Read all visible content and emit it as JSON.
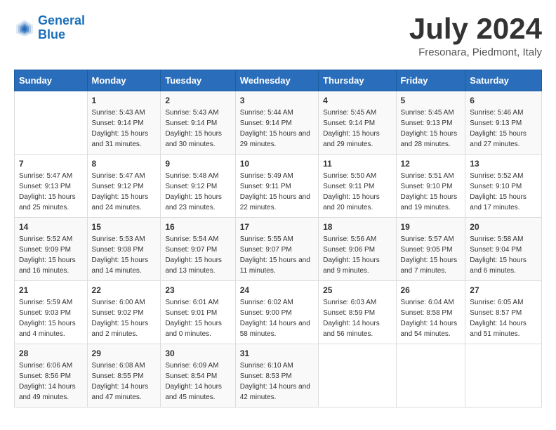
{
  "header": {
    "logo_line1": "General",
    "logo_line2": "Blue",
    "month": "July 2024",
    "location": "Fresonara, Piedmont, Italy"
  },
  "days_of_week": [
    "Sunday",
    "Monday",
    "Tuesday",
    "Wednesday",
    "Thursday",
    "Friday",
    "Saturday"
  ],
  "weeks": [
    [
      {
        "day": "",
        "sunrise": "",
        "sunset": "",
        "daylight": ""
      },
      {
        "day": "1",
        "sunrise": "Sunrise: 5:43 AM",
        "sunset": "Sunset: 9:14 PM",
        "daylight": "Daylight: 15 hours and 31 minutes."
      },
      {
        "day": "2",
        "sunrise": "Sunrise: 5:43 AM",
        "sunset": "Sunset: 9:14 PM",
        "daylight": "Daylight: 15 hours and 30 minutes."
      },
      {
        "day": "3",
        "sunrise": "Sunrise: 5:44 AM",
        "sunset": "Sunset: 9:14 PM",
        "daylight": "Daylight: 15 hours and 29 minutes."
      },
      {
        "day": "4",
        "sunrise": "Sunrise: 5:45 AM",
        "sunset": "Sunset: 9:14 PM",
        "daylight": "Daylight: 15 hours and 29 minutes."
      },
      {
        "day": "5",
        "sunrise": "Sunrise: 5:45 AM",
        "sunset": "Sunset: 9:13 PM",
        "daylight": "Daylight: 15 hours and 28 minutes."
      },
      {
        "day": "6",
        "sunrise": "Sunrise: 5:46 AM",
        "sunset": "Sunset: 9:13 PM",
        "daylight": "Daylight: 15 hours and 27 minutes."
      }
    ],
    [
      {
        "day": "7",
        "sunrise": "Sunrise: 5:47 AM",
        "sunset": "Sunset: 9:13 PM",
        "daylight": "Daylight: 15 hours and 25 minutes."
      },
      {
        "day": "8",
        "sunrise": "Sunrise: 5:47 AM",
        "sunset": "Sunset: 9:12 PM",
        "daylight": "Daylight: 15 hours and 24 minutes."
      },
      {
        "day": "9",
        "sunrise": "Sunrise: 5:48 AM",
        "sunset": "Sunset: 9:12 PM",
        "daylight": "Daylight: 15 hours and 23 minutes."
      },
      {
        "day": "10",
        "sunrise": "Sunrise: 5:49 AM",
        "sunset": "Sunset: 9:11 PM",
        "daylight": "Daylight: 15 hours and 22 minutes."
      },
      {
        "day": "11",
        "sunrise": "Sunrise: 5:50 AM",
        "sunset": "Sunset: 9:11 PM",
        "daylight": "Daylight: 15 hours and 20 minutes."
      },
      {
        "day": "12",
        "sunrise": "Sunrise: 5:51 AM",
        "sunset": "Sunset: 9:10 PM",
        "daylight": "Daylight: 15 hours and 19 minutes."
      },
      {
        "day": "13",
        "sunrise": "Sunrise: 5:52 AM",
        "sunset": "Sunset: 9:10 PM",
        "daylight": "Daylight: 15 hours and 17 minutes."
      }
    ],
    [
      {
        "day": "14",
        "sunrise": "Sunrise: 5:52 AM",
        "sunset": "Sunset: 9:09 PM",
        "daylight": "Daylight: 15 hours and 16 minutes."
      },
      {
        "day": "15",
        "sunrise": "Sunrise: 5:53 AM",
        "sunset": "Sunset: 9:08 PM",
        "daylight": "Daylight: 15 hours and 14 minutes."
      },
      {
        "day": "16",
        "sunrise": "Sunrise: 5:54 AM",
        "sunset": "Sunset: 9:07 PM",
        "daylight": "Daylight: 15 hours and 13 minutes."
      },
      {
        "day": "17",
        "sunrise": "Sunrise: 5:55 AM",
        "sunset": "Sunset: 9:07 PM",
        "daylight": "Daylight: 15 hours and 11 minutes."
      },
      {
        "day": "18",
        "sunrise": "Sunrise: 5:56 AM",
        "sunset": "Sunset: 9:06 PM",
        "daylight": "Daylight: 15 hours and 9 minutes."
      },
      {
        "day": "19",
        "sunrise": "Sunrise: 5:57 AM",
        "sunset": "Sunset: 9:05 PM",
        "daylight": "Daylight: 15 hours and 7 minutes."
      },
      {
        "day": "20",
        "sunrise": "Sunrise: 5:58 AM",
        "sunset": "Sunset: 9:04 PM",
        "daylight": "Daylight: 15 hours and 6 minutes."
      }
    ],
    [
      {
        "day": "21",
        "sunrise": "Sunrise: 5:59 AM",
        "sunset": "Sunset: 9:03 PM",
        "daylight": "Daylight: 15 hours and 4 minutes."
      },
      {
        "day": "22",
        "sunrise": "Sunrise: 6:00 AM",
        "sunset": "Sunset: 9:02 PM",
        "daylight": "Daylight: 15 hours and 2 minutes."
      },
      {
        "day": "23",
        "sunrise": "Sunrise: 6:01 AM",
        "sunset": "Sunset: 9:01 PM",
        "daylight": "Daylight: 15 hours and 0 minutes."
      },
      {
        "day": "24",
        "sunrise": "Sunrise: 6:02 AM",
        "sunset": "Sunset: 9:00 PM",
        "daylight": "Daylight: 14 hours and 58 minutes."
      },
      {
        "day": "25",
        "sunrise": "Sunrise: 6:03 AM",
        "sunset": "Sunset: 8:59 PM",
        "daylight": "Daylight: 14 hours and 56 minutes."
      },
      {
        "day": "26",
        "sunrise": "Sunrise: 6:04 AM",
        "sunset": "Sunset: 8:58 PM",
        "daylight": "Daylight: 14 hours and 54 minutes."
      },
      {
        "day": "27",
        "sunrise": "Sunrise: 6:05 AM",
        "sunset": "Sunset: 8:57 PM",
        "daylight": "Daylight: 14 hours and 51 minutes."
      }
    ],
    [
      {
        "day": "28",
        "sunrise": "Sunrise: 6:06 AM",
        "sunset": "Sunset: 8:56 PM",
        "daylight": "Daylight: 14 hours and 49 minutes."
      },
      {
        "day": "29",
        "sunrise": "Sunrise: 6:08 AM",
        "sunset": "Sunset: 8:55 PM",
        "daylight": "Daylight: 14 hours and 47 minutes."
      },
      {
        "day": "30",
        "sunrise": "Sunrise: 6:09 AM",
        "sunset": "Sunset: 8:54 PM",
        "daylight": "Daylight: 14 hours and 45 minutes."
      },
      {
        "day": "31",
        "sunrise": "Sunrise: 6:10 AM",
        "sunset": "Sunset: 8:53 PM",
        "daylight": "Daylight: 14 hours and 42 minutes."
      },
      {
        "day": "",
        "sunrise": "",
        "sunset": "",
        "daylight": ""
      },
      {
        "day": "",
        "sunrise": "",
        "sunset": "",
        "daylight": ""
      },
      {
        "day": "",
        "sunrise": "",
        "sunset": "",
        "daylight": ""
      }
    ]
  ]
}
